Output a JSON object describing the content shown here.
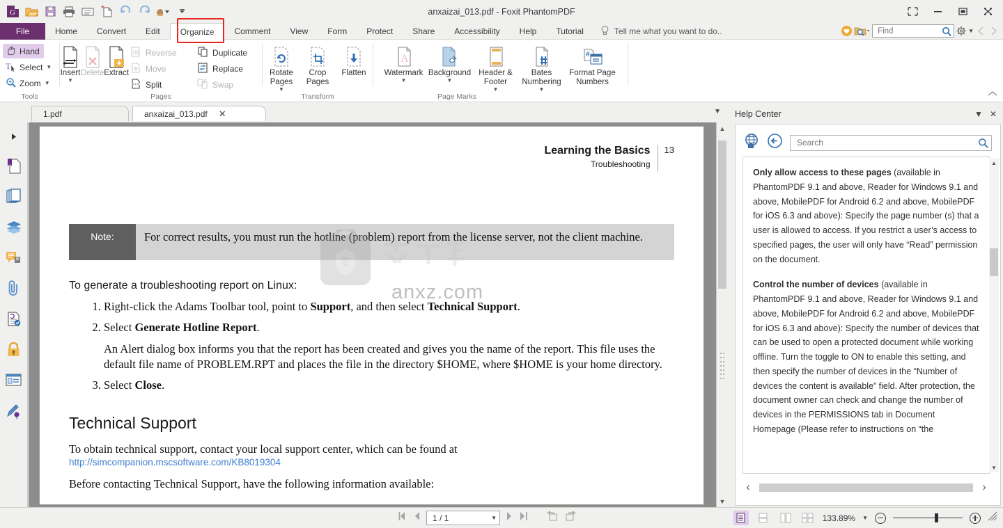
{
  "window": {
    "title": "anxaizai_013.pdf - Foxit PhantomPDF",
    "minimize": "—",
    "maximize": "□",
    "close": "✕",
    "fullscreen_icon": "expand-icon"
  },
  "quick_access": [
    {
      "name": "foxit-logo-icon",
      "label": "G"
    },
    {
      "name": "open-icon",
      "label": "Open"
    },
    {
      "name": "save-icon",
      "label": "Save"
    },
    {
      "name": "print-icon",
      "label": "Print"
    },
    {
      "name": "email-icon",
      "label": "Email"
    },
    {
      "name": "new-from-file-icon",
      "label": "Create PDF"
    },
    {
      "name": "undo-icon",
      "label": "Undo"
    },
    {
      "name": "redo-icon",
      "label": "Redo"
    },
    {
      "name": "customize-icon",
      "label": "Customize"
    }
  ],
  "menu": {
    "file_label": "File",
    "items": [
      {
        "label": "Home",
        "active": false
      },
      {
        "label": "Convert",
        "active": false
      },
      {
        "label": "Edit",
        "active": false
      },
      {
        "label": "Organize",
        "active": true
      },
      {
        "label": "Comment",
        "active": false
      },
      {
        "label": "View",
        "active": false
      },
      {
        "label": "Form",
        "active": false
      },
      {
        "label": "Protect",
        "active": false
      },
      {
        "label": "Share",
        "active": false
      },
      {
        "label": "Accessibility",
        "active": false
      },
      {
        "label": "Help",
        "active": false
      },
      {
        "label": "Tutorial",
        "active": false
      }
    ],
    "tell_me": "Tell me what you want to do..",
    "find_placeholder": "Find",
    "find_value": ""
  },
  "ribbon": {
    "groups": [
      {
        "label": "Tools",
        "tools": [
          {
            "label": "Hand",
            "icon": "hand-icon",
            "selected": true,
            "caret": false
          },
          {
            "label": "Select",
            "icon": "select-text-icon",
            "selected": false,
            "caret": true
          },
          {
            "label": "Zoom",
            "icon": "zoom-in-icon",
            "selected": false,
            "caret": true
          }
        ]
      },
      {
        "label": "Pages",
        "big": [
          {
            "label": "Insert",
            "icon": "insert-pages-icon",
            "caret": true,
            "disabled": false
          },
          {
            "label": "Delete",
            "icon": "delete-pages-icon",
            "caret": false,
            "disabled": true
          },
          {
            "label": "Extract",
            "icon": "extract-pages-icon",
            "caret": false,
            "disabled": false
          }
        ],
        "small_left": [
          {
            "label": "Reverse",
            "icon": "reverse-pages-icon",
            "disabled": true
          },
          {
            "label": "Move",
            "icon": "move-pages-icon",
            "disabled": true
          },
          {
            "label": "Split",
            "icon": "split-pages-icon",
            "disabled": false
          }
        ],
        "small_right": [
          {
            "label": "Duplicate",
            "icon": "duplicate-pages-icon",
            "disabled": false
          },
          {
            "label": "Replace",
            "icon": "replace-pages-icon",
            "disabled": false
          },
          {
            "label": "Swap",
            "icon": "swap-pages-icon",
            "disabled": true
          }
        ]
      },
      {
        "label": "Transform",
        "big": [
          {
            "label": "Rotate Pages",
            "icon": "rotate-pages-icon",
            "caret": true,
            "disabled": false
          },
          {
            "label": "Crop Pages",
            "icon": "crop-pages-icon",
            "caret": false,
            "disabled": false
          },
          {
            "label": "Flatten",
            "icon": "flatten-icon",
            "caret": false,
            "disabled": false
          }
        ]
      },
      {
        "label": "Page Marks",
        "big": [
          {
            "label": "Watermark",
            "icon": "watermark-icon",
            "caret": true,
            "disabled": false
          },
          {
            "label": "Background",
            "icon": "background-icon",
            "caret": true,
            "disabled": false
          },
          {
            "label": "Header & Footer",
            "icon": "header-footer-icon",
            "caret": true,
            "disabled": false
          },
          {
            "label": "Bates Numbering",
            "icon": "bates-numbering-icon",
            "caret": true,
            "disabled": false
          },
          {
            "label": "Format Page Numbers",
            "icon": "format-page-numbers-icon",
            "caret": false,
            "disabled": false
          }
        ]
      }
    ]
  },
  "doc_tabs": [
    {
      "label": "1.pdf",
      "active": false,
      "closable": false
    },
    {
      "label": "anxaizai_013.pdf",
      "active": true,
      "closable": true
    }
  ],
  "left_sidebar": [
    {
      "name": "sidebar-expand-arrow",
      "icon": "triangle-right-icon"
    },
    {
      "name": "sidebar-item-bookmarks",
      "icon": "bookmark-page-icon"
    },
    {
      "name": "sidebar-item-page-thumbnails",
      "icon": "page-thumbnails-icon"
    },
    {
      "name": "sidebar-item-layers",
      "icon": "layers-icon"
    },
    {
      "name": "sidebar-item-comments",
      "icon": "comments-icon"
    },
    {
      "name": "sidebar-item-attachments",
      "icon": "paperclip-icon"
    },
    {
      "name": "sidebar-item-digital-signatures",
      "icon": "signature-doc-icon"
    },
    {
      "name": "sidebar-item-security",
      "icon": "lock-icon"
    },
    {
      "name": "sidebar-item-fields",
      "icon": "fields-icon"
    },
    {
      "name": "sidebar-item-sign",
      "icon": "sign-pen-icon"
    }
  ],
  "document": {
    "header_title": "Learning the Basics",
    "header_subtitle": "Troubleshooting",
    "page_number": "13",
    "note_label": "Note:",
    "note_text": "For correct results, you must run the hotline (problem) report from the license server, not the client machine.",
    "lead": "To generate a troubleshooting report on Linux:",
    "step1_a": "Right-click the Adams Toolbar tool, point to ",
    "step1_b": "Support",
    "step1_c": ", and then select ",
    "step1_d": "Technical Support",
    "step1_e": ".",
    "step2_a": "Select ",
    "step2_b": "Generate Hotline Report",
    "step2_c": ".",
    "step2_note": "An Alert dialog box informs you that the report has been created and gives you the name of the report. This file uses the default file name of PROBLEM.RPT and places the file in the directory $HOME, where $HOME is your home directory.",
    "step3_a": "Select ",
    "step3_b": "Close",
    "step3_c": ".",
    "section_title": "Technical Support",
    "para1": "To obtain technical support, contact your local support center, which can be found at",
    "link": "http://simcompanion.mscsoftware.com/KB8019304",
    "para2": "Before contacting Technical Support, have the following information available:",
    "watermark_text": "anxz.com"
  },
  "help_center": {
    "title": "Help Center",
    "collapse_icon": "chevron-down-icon",
    "close_icon": "close-icon",
    "home_icon": "globe-home-icon",
    "back_icon": "back-arrow-icon",
    "search_placeholder": "Search",
    "search_value": "",
    "search_icon": "search-icon",
    "paragraphs": [
      {
        "bold": "Only allow access to these pages",
        "rest": " (available in PhantomPDF 9.1 and above, Reader for Windows 9.1 and above, MobilePDF for Android 6.2 and above, MobilePDF for iOS 6.3 and above): Specify the page number (s) that a user is allowed to access. If you restrict a user’s access to specified pages, the user will only have “Read” permission on the document."
      },
      {
        "bold": "Control the number of devices",
        "rest": " (available in PhantomPDF 9.1 and above, Reader for Windows 9.1 and above, MobilePDF for Android 6.2 and above, MobilePDF for iOS 6.3 and above): Specify the number of devices that can be used to open a protected document while working offline. Turn the toggle to ON to enable this setting, and then specify the number of devices in the “Number of devices the content is available” field. After protection, the document owner can check and change the number of devices in the PERMISSIONS tab in Document Homepage (Please refer to instructions on “the"
      }
    ],
    "hscroll_left": "‹",
    "hscroll_right": "›"
  },
  "status_bar": {
    "first_page_icon": "first-page-icon",
    "prev_page_icon": "prev-page-icon",
    "page_value": "1 / 1",
    "next_page_icon": "next-page-icon",
    "last_page_icon": "last-page-icon",
    "prev_view_icon": "previous-view-icon",
    "next_view_icon": "next-view-icon",
    "view_modes": [
      {
        "name": "single-page-view",
        "selected": true
      },
      {
        "name": "continuous-view",
        "selected": false
      },
      {
        "name": "facing-view",
        "selected": false
      },
      {
        "name": "continuous-facing-view",
        "selected": false
      }
    ],
    "zoom_level": "133.89%",
    "zoom_caret": "▾",
    "zoom_out_icon": "zoom-out-icon",
    "zoom_in_icon": "zoom-in-icon",
    "resize_grip_icon": "resize-grip-icon"
  },
  "colors": {
    "file_tab": "#6c2f6e",
    "highlight_box": "#e8241c",
    "selection": "#e2ccec",
    "link": "#3f7fd0",
    "note_label_bg": "#5f5f5f",
    "note_body_bg": "#d4d4d4"
  }
}
